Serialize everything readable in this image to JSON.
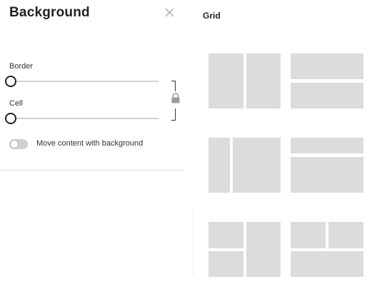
{
  "panel": {
    "title": "Background",
    "border_label": "Border",
    "cell_label": "Cell",
    "border_value": 0,
    "cell_value": 0,
    "toggle_label": "Move content with background",
    "toggle_on": false
  },
  "grid": {
    "title": "Grid",
    "layouts": [
      "two-columns",
      "two-rows",
      "narrow-left-wide-right",
      "thin-top-large-bottom",
      "two-stacked-left-tall-right",
      "two-top-one-bottom"
    ]
  },
  "colors": {
    "cell_fill": "#dcdcdc",
    "track": "#d0d0d0",
    "toggle_off": "#cfcfcf"
  },
  "icons": {
    "close": "close-icon",
    "lock": "lock-icon"
  }
}
